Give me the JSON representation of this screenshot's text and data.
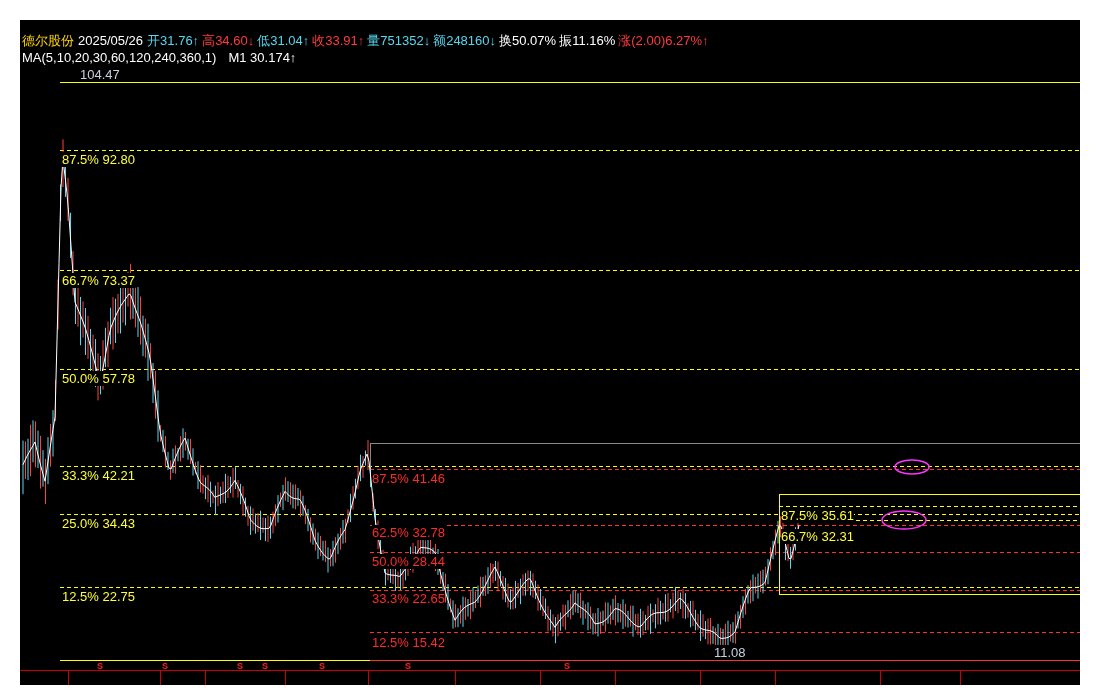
{
  "quote_header": {
    "stock_name": "德尔股份",
    "date": "2025/05/26",
    "fields": [
      {
        "text": "开31.76↑",
        "color": "#55d8f0"
      },
      {
        "text": "高34.60↓",
        "color": "#ff3b3b"
      },
      {
        "text": "低31.04↑",
        "color": "#55d8f0"
      },
      {
        "text": "收33.91↑",
        "color": "#ff3b3b"
      },
      {
        "text": "量751352↓",
        "color": "#55d8f0"
      },
      {
        "text": "额248160↓",
        "color": "#55d8f0"
      },
      {
        "text": "换50.07%",
        "color": "#ffffff"
      },
      {
        "text": "振11.16%",
        "color": "#ffffff"
      },
      {
        "text": "涨(2.00)6.27%↑",
        "color": "#ff3b3b"
      }
    ]
  },
  "indicator_line": {
    "ma_params": "MA(5,10,20,30,60,120,240,360,1)",
    "m1": "M1 30.174↑"
  },
  "chart": {
    "high_label": "104.47",
    "low_label": "11.08",
    "fib_levels": [
      {
        "text": "87.5% 92.80",
        "color": "#ffff33"
      },
      {
        "text": "66.7% 73.37",
        "color": "#ffff33"
      },
      {
        "text": "50.0% 57.78",
        "color": "#ffff33"
      },
      {
        "text": "33.3% 42.21",
        "color": "#ffff33"
      },
      {
        "text": "25.0% 34.43",
        "color": "#ffff33"
      },
      {
        "text": "12.5% 22.75",
        "color": "#ffff33"
      },
      {
        "text": "87.5% 41.46",
        "color": "#ff2a2a"
      },
      {
        "text": "62.5% 32.78",
        "color": "#ff2a2a"
      },
      {
        "text": "50.0% 28.44",
        "color": "#ff2a2a"
      },
      {
        "text": "33.3% 22.65",
        "color": "#ff2a2a"
      },
      {
        "text": "12.5% 15.42",
        "color": "#ff2a2a"
      },
      {
        "text": "87.5% 35.61",
        "color": "#ffff33"
      },
      {
        "text": "66.7% 32.31",
        "color": "#ffff33"
      }
    ],
    "signal_markers": [
      "S",
      "S",
      "S",
      "S",
      "S",
      "S",
      "S"
    ]
  }
}
